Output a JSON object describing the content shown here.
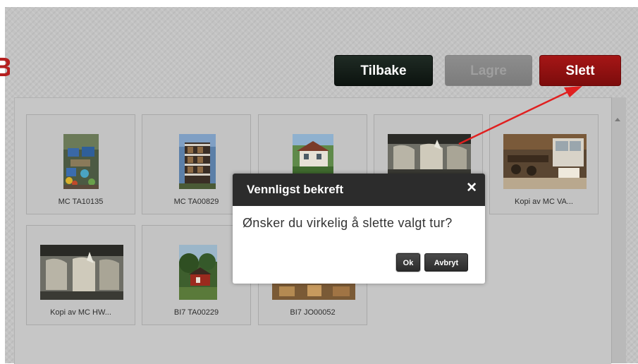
{
  "toolbar": {
    "back_label": "Tilbake",
    "save_label": "Lagre",
    "delete_label": "Slett"
  },
  "tiles": [
    {
      "label": "MC TA10135",
      "thumb": "garden-patio-photo"
    },
    {
      "label": "MC TA00829",
      "thumb": "apartment-building-photo"
    },
    {
      "label": "",
      "thumb": "white-house-photo"
    },
    {
      "label": "",
      "thumb": "lounge-chairs-photo"
    },
    {
      "label": "Kopi av MC VA...",
      "thumb": "kitchen-interior-photo"
    },
    {
      "label": "Kopi av MC HW...",
      "thumb": "lounge-chairs-photo"
    },
    {
      "label": "BI7 TA00229",
      "thumb": "red-cabin-photo"
    },
    {
      "label": "BI7 JO00052",
      "thumb": "interior-photo"
    }
  ],
  "dialog": {
    "title": "Vennligst bekreft",
    "message": "Ønsker du virkelig å slette valgt tur?",
    "ok_label": "Ok",
    "cancel_label": "Avbryt"
  },
  "colors": {
    "accent_red": "#a51616",
    "annotation_arrow": "#e02020",
    "dialog_header": "#2c2c2c"
  }
}
